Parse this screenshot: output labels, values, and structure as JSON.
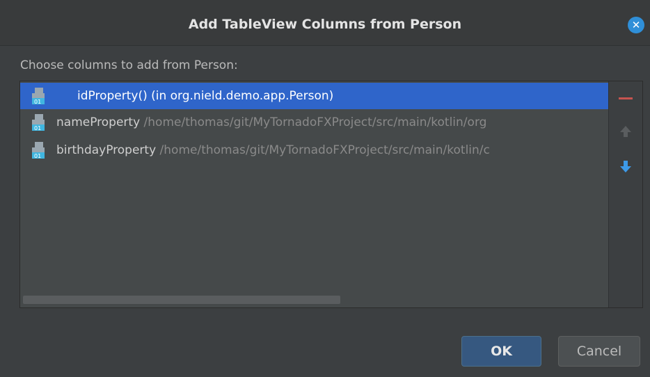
{
  "dialog": {
    "title": "Add TableView Columns from Person",
    "prompt": "Choose columns to add from Person:"
  },
  "list": {
    "items": [
      {
        "name": "idProperty() (in org.nield.demo.app.Person)",
        "path": "",
        "selected": true
      },
      {
        "name": "nameProperty",
        "path": " /home/thomas/git/MyTornadoFXProject/src/main/kotlin/org",
        "selected": false
      },
      {
        "name": "birthdayProperty",
        "path": " /home/thomas/git/MyTornadoFXProject/src/main/kotlin/c",
        "selected": false
      }
    ]
  },
  "toolbar": {
    "remove_icon": "minus-icon",
    "move_up_icon": "arrow-up-icon",
    "move_down_icon": "arrow-down-icon"
  },
  "buttons": {
    "ok_label": "OK",
    "cancel_label": "Cancel"
  },
  "colors": {
    "background": "#3c3f41",
    "selection": "#2f65ca",
    "remove": "#c75450",
    "arrow_enabled": "#3d9ae8",
    "arrow_disabled": "#5a5d5f"
  }
}
